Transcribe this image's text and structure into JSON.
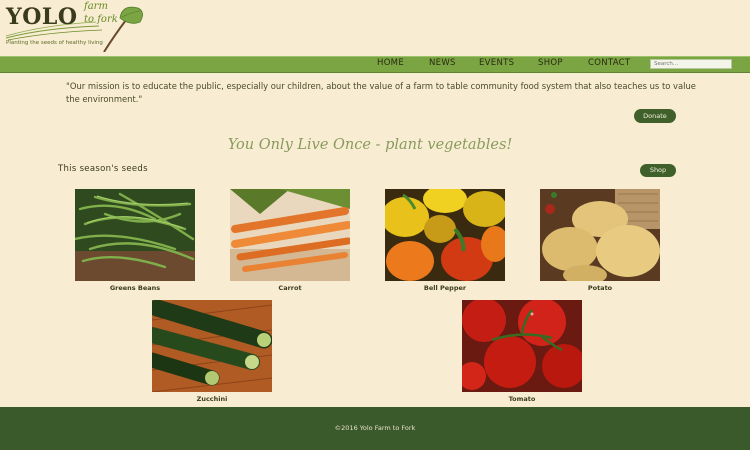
{
  "brand": {
    "name": "YOLO",
    "sub1": "farm",
    "sub2": "to fork",
    "tagline": "Planting the seeds of healthy living"
  },
  "nav": {
    "items": [
      "HOME",
      "NEWS",
      "EVENTS",
      "SHOP",
      "CONTACT"
    ],
    "search_placeholder": "Search..."
  },
  "mission": "\"Our mission is to educate the public, especially our children, about the value of a farm to table community food system that also teaches us to value the environment.\"",
  "buttons": {
    "donate": "Donate",
    "shop": "Shop"
  },
  "headline": "You Only Live Once - plant vegetables!",
  "section_title": "This season's seeds",
  "products": [
    "Greens Beans",
    "Carrot",
    "Bell Pepper",
    "Potato",
    "Zucchini",
    "Tomato"
  ],
  "footer": "©2016 Yolo Farm to Fork",
  "colors": {
    "background": "#f8edd2",
    "nav": "#7ba542",
    "button": "#3f5f2b",
    "footer": "#3b5a2c"
  }
}
